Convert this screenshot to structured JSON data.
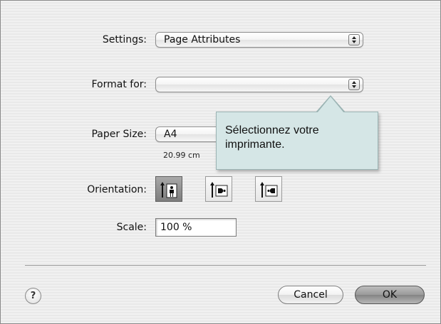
{
  "settings": {
    "label": "Settings:",
    "value": "Page Attributes"
  },
  "format_for": {
    "label": "Format for:",
    "value": ""
  },
  "paper_size": {
    "label": "Paper Size:",
    "value": "A4",
    "dimensions": "20.99 cm"
  },
  "orientation": {
    "label": "Orientation:",
    "options": [
      {
        "name": "portrait",
        "selected": true
      },
      {
        "name": "landscape",
        "selected": false
      },
      {
        "name": "reverse-landscape",
        "selected": false
      }
    ]
  },
  "scale": {
    "label": "Scale:",
    "value": "100 %"
  },
  "tooltip": {
    "text": "Sélectionnez votre imprimante."
  },
  "buttons": {
    "help": "?",
    "cancel": "Cancel",
    "ok": "OK"
  },
  "icons": {
    "popup_arrows": "up-down-arrows-icon",
    "portrait": "portrait-orientation-icon",
    "landscape": "landscape-orientation-icon",
    "reverse_landscape": "reverse-landscape-orientation-icon"
  }
}
